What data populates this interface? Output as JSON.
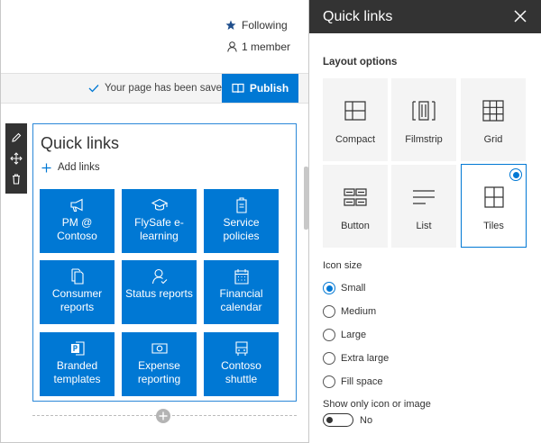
{
  "header": {
    "following_label": "Following",
    "members_label": "1 member"
  },
  "command_bar": {
    "saved_status": "Your page has been saved",
    "publish_label": "Publish"
  },
  "webpart": {
    "title": "Quick links",
    "add_links_label": "Add links",
    "tiles": [
      {
        "icon": "megaphone-icon",
        "label": "PM @ Contoso"
      },
      {
        "icon": "graduation-cap-icon",
        "label": "FlySafe e-learning"
      },
      {
        "icon": "clipboard-icon",
        "label": "Service policies"
      },
      {
        "icon": "documents-icon",
        "label": "Consumer reports"
      },
      {
        "icon": "person-status-icon",
        "label": "Status reports"
      },
      {
        "icon": "calendar-icon",
        "label": "Financial calendar"
      },
      {
        "icon": "powerpoint-icon",
        "label": "Branded templates"
      },
      {
        "icon": "money-icon",
        "label": "Expense reporting"
      },
      {
        "icon": "bus-icon",
        "label": "Contoso shuttle"
      }
    ]
  },
  "panel": {
    "title": "Quick links",
    "layout_section_title": "Layout options",
    "layouts": [
      {
        "label": "Compact",
        "icon": "compact-layout-icon",
        "selected": false
      },
      {
        "label": "Filmstrip",
        "icon": "filmstrip-layout-icon",
        "selected": false
      },
      {
        "label": "Grid",
        "icon": "grid-layout-icon",
        "selected": false
      },
      {
        "label": "Button",
        "icon": "button-layout-icon",
        "selected": false
      },
      {
        "label": "List",
        "icon": "list-layout-icon",
        "selected": false
      },
      {
        "label": "Tiles",
        "icon": "tiles-layout-icon",
        "selected": true
      }
    ],
    "icon_size_label": "Icon size",
    "icon_sizes": [
      {
        "label": "Small",
        "selected": true
      },
      {
        "label": "Medium",
        "selected": false
      },
      {
        "label": "Large",
        "selected": false
      },
      {
        "label": "Extra large",
        "selected": false
      },
      {
        "label": "Fill space",
        "selected": false
      }
    ],
    "show_only_label": "Show only icon or image",
    "show_only_state": "No"
  },
  "colors": {
    "accent": "#0078d4",
    "panel_header": "#333333"
  }
}
